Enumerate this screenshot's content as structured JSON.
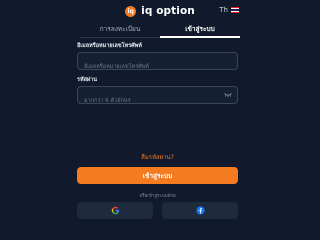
{
  "header": {
    "logo_letter": "iq",
    "brand_name": "iq option",
    "language_code": "Th",
    "language_flag_icon": "thailand-flag-icon"
  },
  "tabs": [
    {
      "label": "การลงทะเบียน",
      "active": false
    },
    {
      "label": "เข้าสู่ระบบ",
      "active": true
    }
  ],
  "form": {
    "email_label": "อีเมลหรือหมายเลขโทรศัพท์",
    "email_placeholder": "อีเมลหรือหมายเลขโทรศัพท์",
    "email_value": "",
    "password_label": "รหัสผ่าน",
    "password_placeholder": "มากกว่า 6 ตัวอักษร",
    "password_value": "",
    "password_toggle_icon": "eye-icon",
    "forgot_password": "ลืมรหัสผ่าน?",
    "login_button": "เข้าสู่ระบบ",
    "or_text": "หรือเข้าสู่ระบบด้วย"
  },
  "social": [
    {
      "name": "google",
      "icon": "google-icon"
    },
    {
      "name": "facebook",
      "icon": "facebook-icon"
    }
  ],
  "colors": {
    "background": "#101a2c",
    "accent": "#f47b20",
    "input_border": "#3a4659",
    "social_button": "#1e2a3d",
    "facebook_blue": "#1877f2"
  }
}
